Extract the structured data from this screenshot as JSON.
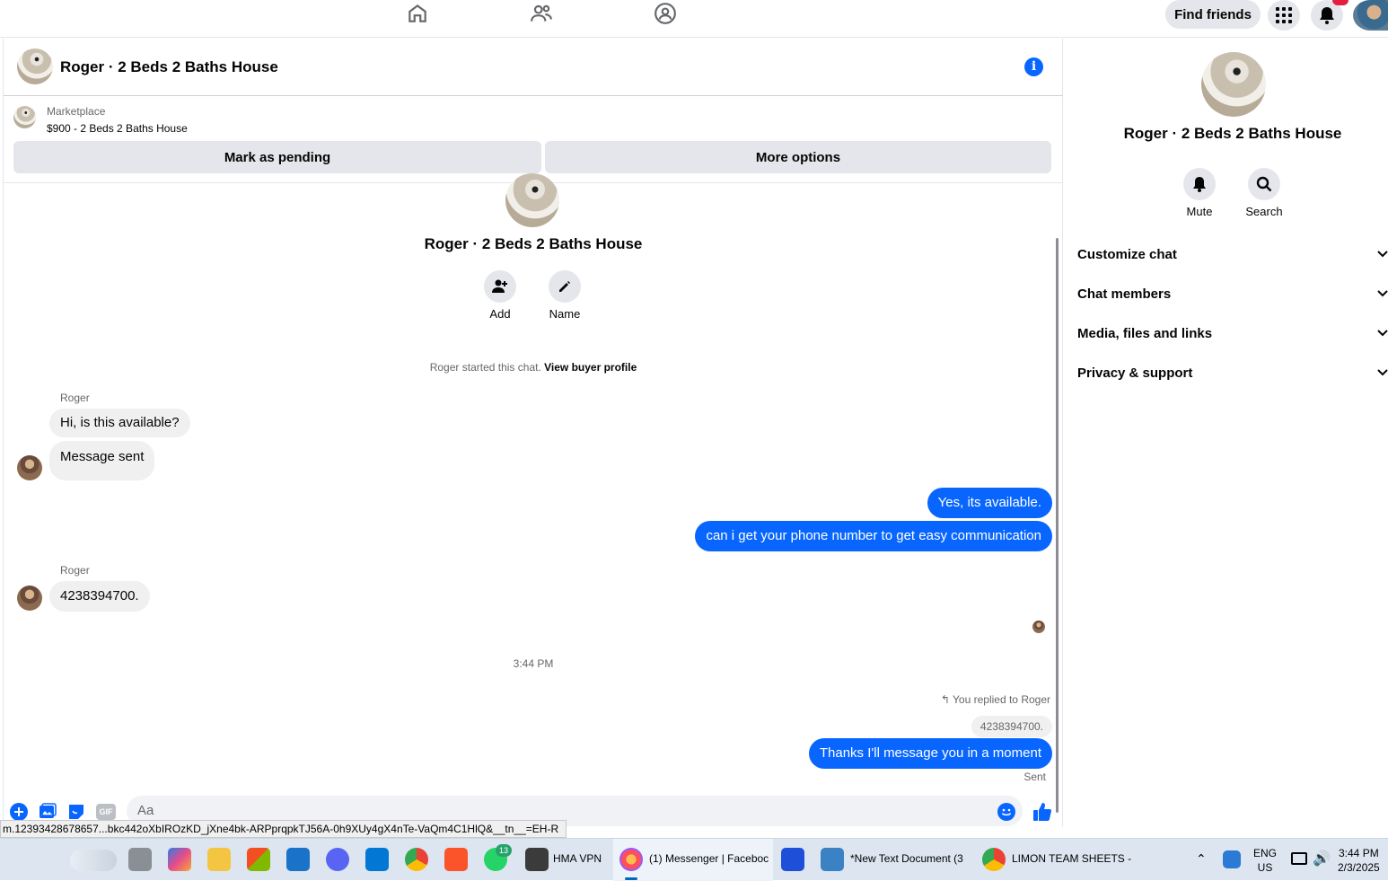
{
  "topbar": {
    "find_friends": "Find friends",
    "notification_count": ""
  },
  "chat": {
    "title": "Roger · 2 Beds 2 Baths House",
    "marketplace_label": "Marketplace",
    "marketplace_item": "$900 - 2 Beds 2 Baths House",
    "mark_pending": "Mark as pending",
    "more_options": "More options",
    "intro_name": "Roger · 2 Beds 2 Baths House",
    "add_label": "Add",
    "name_label": "Name",
    "started_text": "Roger started this chat. ",
    "view_buyer_profile": "View buyer profile",
    "messages": [
      {
        "sender": "Roger",
        "text": "Hi, is this available?"
      },
      {
        "text": "Message sent"
      },
      {
        "text": "Yes, its available."
      },
      {
        "text": "can i get your phone number to get easy communication"
      },
      {
        "sender": "Roger",
        "text": "4238394700."
      },
      {
        "text": "Thanks I'll message you in a moment"
      }
    ],
    "timestamp": "3:44 PM",
    "replied_to": "You replied to Roger",
    "quoted_text": "4238394700.",
    "sent_status": "Sent",
    "composer_placeholder": "Aa",
    "gif_label": "GIF"
  },
  "url_tooltip": "m.12393428678657...bkc442oXbIROzKD_jXne4bk-ARPprqpkTJ56A-0h9XUy4gX4nTe-VaQm4C1HlQ&__tn__=EH-R",
  "sidebar": {
    "name": "Roger · 2 Beds 2 Baths House",
    "mute": "Mute",
    "search": "Search",
    "rows": [
      "Customize chat",
      "Chat members",
      "Media, files and links",
      "Privacy & support"
    ]
  },
  "taskbar": {
    "hma_vpn": "HMA VPN",
    "messenger": "(1) Messenger | Faceboc",
    "notepad": "*New Text Document (3",
    "chrome_sheets": "LIMON TEAM SHEETS -",
    "whatsapp_badge": "13",
    "lang_line1": "ENG",
    "lang_line2": "US",
    "time": "3:44 PM",
    "date": "2/3/2025"
  },
  "colors": {
    "accent": "#0866ff",
    "bubble_in": "#f0f0f0",
    "button_bg": "#e4e6eb"
  }
}
